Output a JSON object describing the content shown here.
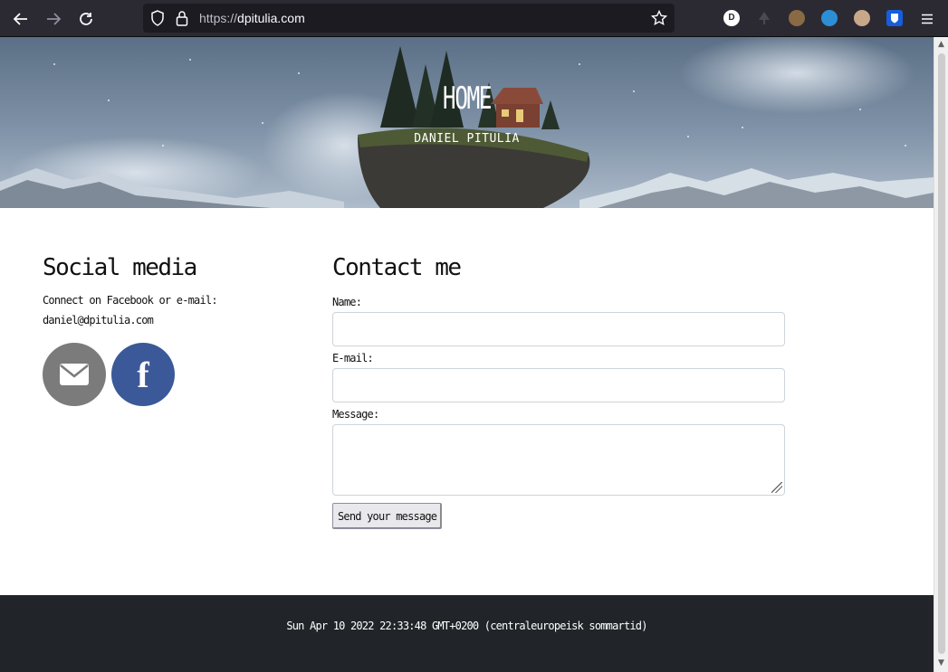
{
  "browser": {
    "url_protocol": "https://",
    "url_host": "dpitulia.com",
    "extensions": [
      "duckduckgo-icon",
      "gray-tree-icon",
      "cookie-icon",
      "blue-bot-icon",
      "owl-icon",
      "bitwarden-icon"
    ]
  },
  "hero": {
    "title": "HOME",
    "subtitle": "DANIEL PITULIA"
  },
  "social": {
    "heading": "Social media",
    "line1": "Connect on Facebook or e-mail:",
    "email": "daniel@dpitulia.com",
    "fb_glyph": "f"
  },
  "contact": {
    "heading": "Contact me",
    "name_label": "Name:",
    "email_label": "E-mail:",
    "message_label": "Message:",
    "send_label": "Send your message"
  },
  "footer": {
    "datetime": "Sun Apr 10 2022 22:33:48 GMT+0200 (centraleuropeisk sommartid)"
  },
  "colors": {
    "toolbar": "#2b2a33",
    "urlbar": "#1c1b22",
    "footer": "#212529",
    "facebook": "#3b5998",
    "mail": "#7b7b7b"
  }
}
